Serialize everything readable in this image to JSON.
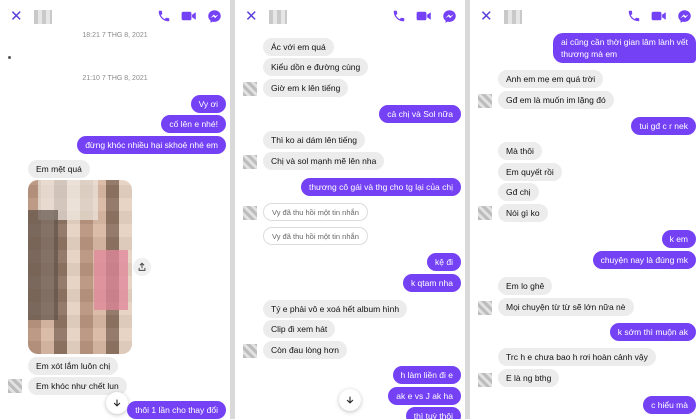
{
  "colors": {
    "accent": "#7441f5",
    "incoming_bubble": "#ececec"
  },
  "icons": [
    "close-icon",
    "phone-icon",
    "video-icon",
    "messenger-icon",
    "share-icon",
    "chevron-down-icon"
  ],
  "panel1": {
    "timestamps": [
      "18:21 7 THG 8, 2021",
      "21:10 7 THG 8, 2021"
    ],
    "messages": [
      {
        "dir": "out",
        "text": "Vy ơi"
      },
      {
        "dir": "out",
        "text": "cố lên e nhé!"
      },
      {
        "dir": "out",
        "text": "đừng khóc nhiều hại skhoẻ nhé em"
      },
      {
        "dir": "in",
        "text": "Em mệt quá"
      },
      {
        "dir": "in",
        "text": "Em xót lắm luôn chị"
      },
      {
        "dir": "in",
        "text": "Em khóc như chết lun"
      },
      {
        "dir": "out",
        "text": "thôi 1 lần cho thay đổi"
      }
    ]
  },
  "panel2": {
    "messages": [
      {
        "dir": "in",
        "text": "Ác với em quá"
      },
      {
        "dir": "in",
        "text": "Kiểu dồn e đường cùng"
      },
      {
        "dir": "in",
        "text": "Giờ em k lên tiếng"
      },
      {
        "dir": "out",
        "text": "cả chị và Sol nữa"
      },
      {
        "dir": "in",
        "text": "Thì ko ai dám lên tiếng"
      },
      {
        "dir": "in",
        "text": "Chị và sol mạnh mẽ lên nha"
      },
      {
        "dir": "out",
        "text": "thương cô gái và thg cho tg lại của chị"
      },
      {
        "dir": "in",
        "text": "Vy đã thu hồi một tin nhắn"
      },
      {
        "dir": "in",
        "text": "Vy đã thu hồi một tin nhắn"
      },
      {
        "dir": "out",
        "text": "kệ đi"
      },
      {
        "dir": "out",
        "text": "k qtam nha"
      },
      {
        "dir": "in",
        "text": "Tý e phải vô e xoá hết album hình"
      },
      {
        "dir": "in",
        "text": "Clip đi xem hát"
      },
      {
        "dir": "in",
        "text": "Còn đau lòng hơn"
      },
      {
        "dir": "out",
        "text": "h làm liền đi e"
      },
      {
        "dir": "out",
        "text": "ak e vs J ak ha"
      },
      {
        "dir": "out",
        "text": "thì tuỳ thôi"
      }
    ]
  },
  "panel3": {
    "messages": [
      {
        "dir": "out",
        "text": "ai cũng cần thời gian lâm lành vết"
      },
      {
        "dir": "out",
        "text": "thương mà em"
      },
      {
        "dir": "in",
        "text": "Anh em mẹ em quá trời"
      },
      {
        "dir": "in",
        "text": "Gđ em là muốn im lặng đó"
      },
      {
        "dir": "out",
        "text": "tui gđ c r nek"
      },
      {
        "dir": "in",
        "text": "Mà thôi"
      },
      {
        "dir": "in",
        "text": "Em quyết rồi"
      },
      {
        "dir": "in",
        "text": "Gđ chị"
      },
      {
        "dir": "in",
        "text": "Nói gì ko"
      },
      {
        "dir": "out",
        "text": "k em"
      },
      {
        "dir": "out",
        "text": "chuyện nay là đúng mk"
      },
      {
        "dir": "in",
        "text": "Em lo ghê"
      },
      {
        "dir": "in",
        "text": "Mọi chuyện từ từ sẽ lớn nữa nè"
      },
      {
        "dir": "out",
        "text": "k sớm thì muộn ak"
      },
      {
        "dir": "in",
        "text": "Trc h e chưa bao h rơi hoàn cảnh vậy"
      },
      {
        "dir": "in",
        "text": "E là ng bthg"
      },
      {
        "dir": "out",
        "text": "c hiểu mà"
      }
    ]
  }
}
